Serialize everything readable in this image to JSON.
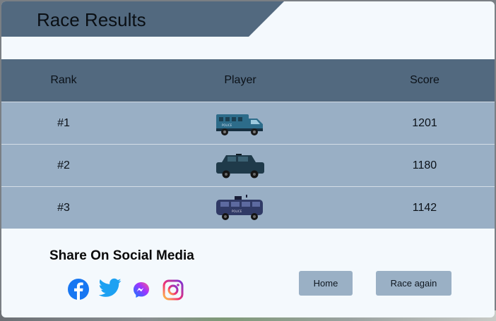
{
  "title": "Race Results",
  "table": {
    "headers": {
      "rank": "Rank",
      "player": "Player",
      "score": "Score"
    },
    "rows": [
      {
        "rank": "#1",
        "player_icon": "police-truck-icon",
        "score": "1201"
      },
      {
        "rank": "#2",
        "player_icon": "police-suv-icon",
        "score": "1180"
      },
      {
        "rank": "#3",
        "player_icon": "police-van-icon",
        "score": "1142"
      }
    ]
  },
  "share": {
    "title": "Share On Social Media",
    "icons": [
      "facebook-icon",
      "twitter-icon",
      "messenger-icon",
      "instagram-icon"
    ]
  },
  "buttons": {
    "home": "Home",
    "race_again": "Race again"
  },
  "colors": {
    "banner": "#52697f",
    "row": "#99afc5",
    "panel": "#f4f9fd",
    "button": "#9ab0c5",
    "facebook": "#1877f2",
    "twitter": "#1da1f2"
  }
}
